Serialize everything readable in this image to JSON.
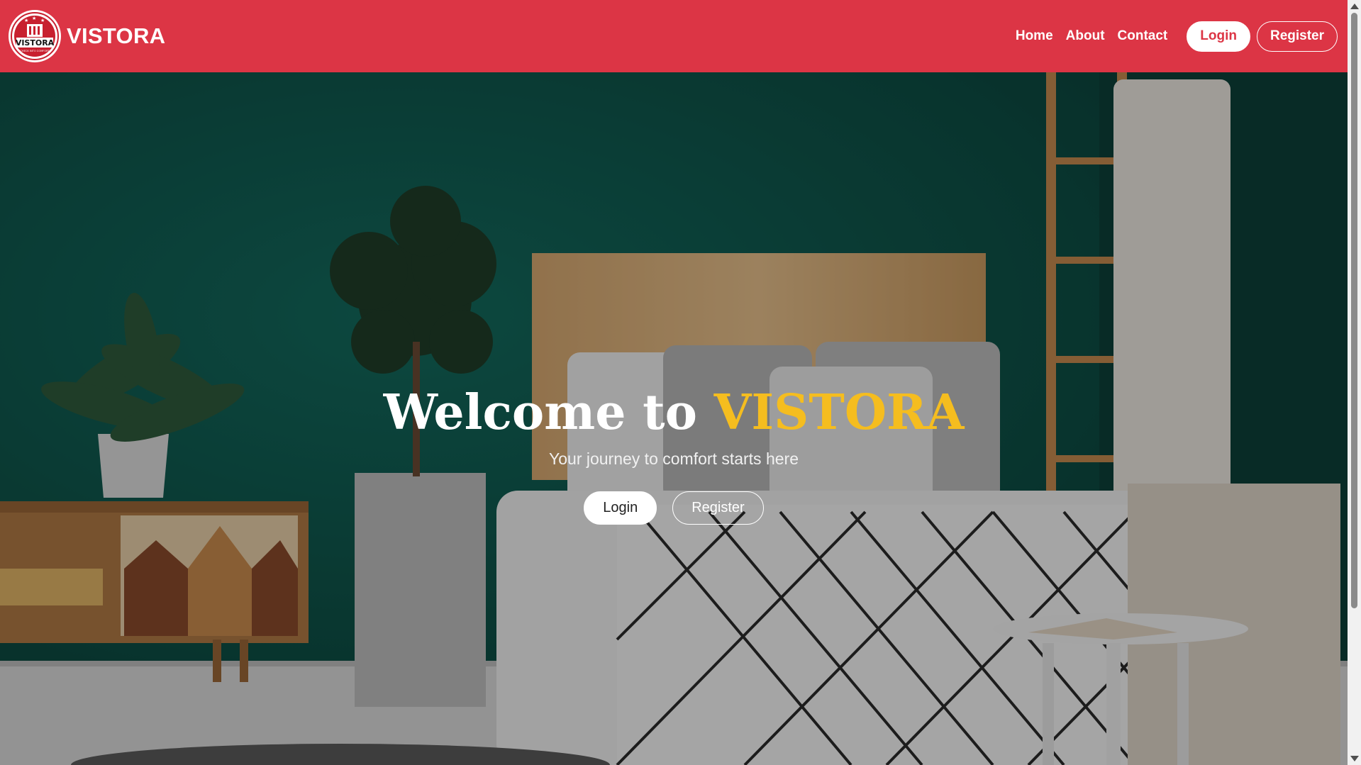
{
  "brand": {
    "name": "VISTORA",
    "logo_text": "VISTORA",
    "logo_tagline": "CHECK INTO COMFORT"
  },
  "nav": {
    "links": [
      {
        "label": "Home"
      },
      {
        "label": "About"
      },
      {
        "label": "Contact"
      }
    ],
    "login_label": "Login",
    "register_label": "Register"
  },
  "hero": {
    "title_prefix": "Welcome to ",
    "title_highlight": "VISTORA",
    "subtitle": "Your journey to comfort starts here",
    "login_label": "Login",
    "register_label": "Register"
  },
  "colors": {
    "brand_red": "#dc3545",
    "accent_gold": "#f5bd1f",
    "wall_green": "#0f4a42"
  }
}
